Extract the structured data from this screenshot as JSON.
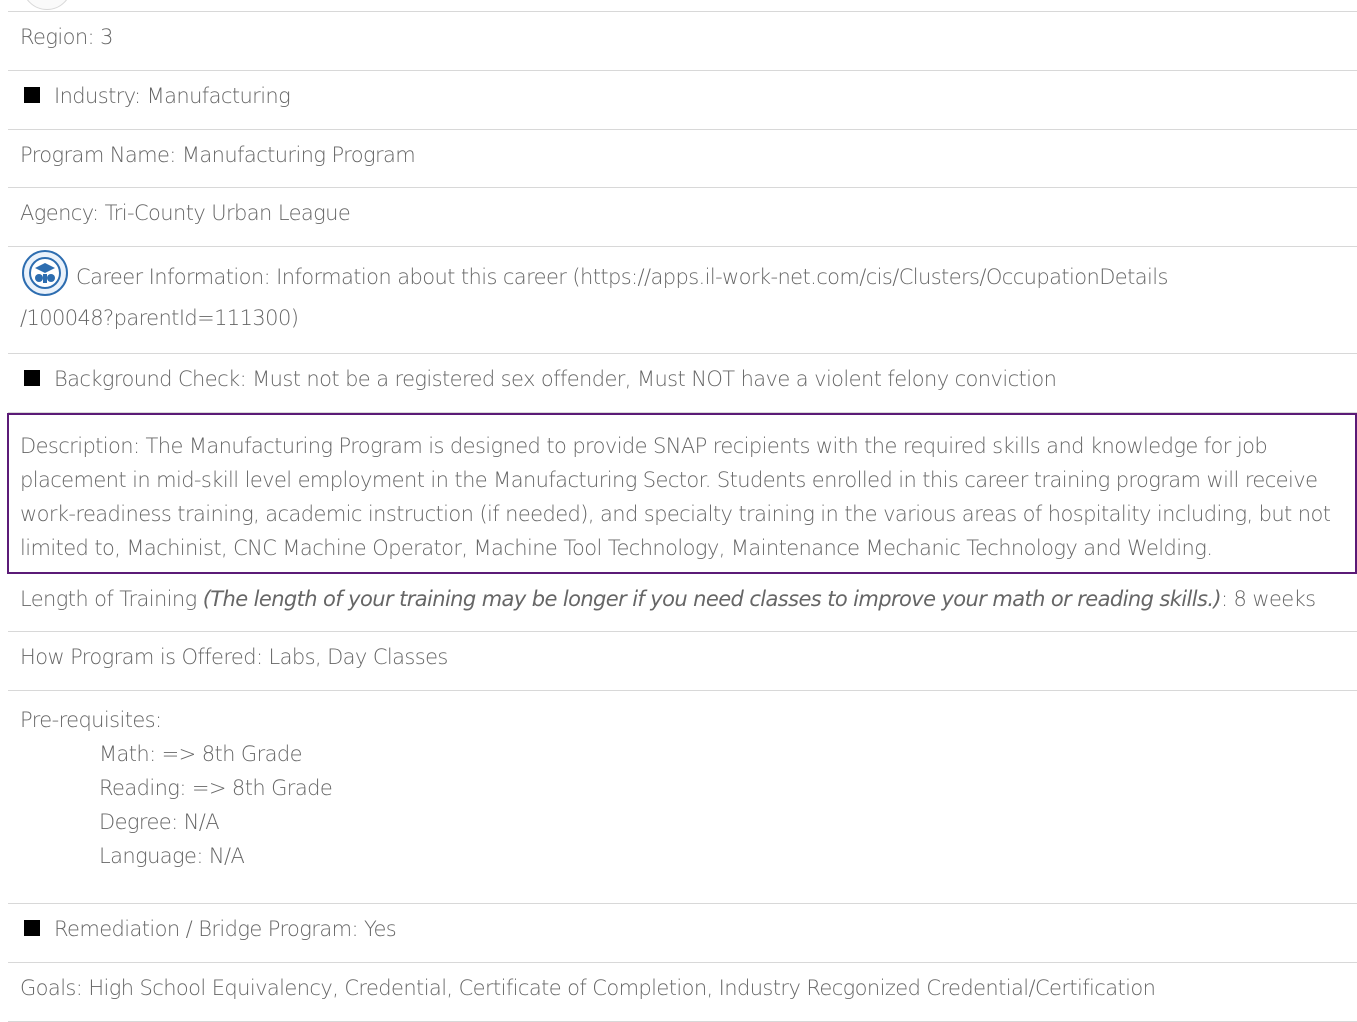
{
  "details": {
    "region": "Region: 3",
    "industry": "Industry: Manufacturing",
    "program_name": "Program Name: Manufacturing Program",
    "agency": "Agency: Tri-County Urban League",
    "career_info_line1": "Career Information: Information about this career (https://apps.il-work-net.com/cis/Clusters/OccupationDetails",
    "career_info_line2": "/100048?parentId=111300)",
    "background_check": "Background Check: Must not be a registered sex offender, Must NOT have a violent felony conviction",
    "description": "Description: The Manufacturing Program is designed to provide SNAP recipients with the required skills and knowledge for job placement in mid-skill level employment in the Manufacturing Sector. Students enrolled in this career training program will receive work-readiness training, academic instruction (if needed), and specialty training in the various areas of hospitality including, but not limited to, Machinist, CNC Machine Operator, Machine Tool Technology, Maintenance Mechanic Technology and Welding.",
    "length_label": "Length of Training ",
    "length_note": "(The length of your training may be longer if you need classes to improve your math or reading skills.)",
    "length_value": ": 8 weeks",
    "how_offered": "How Program is Offered: Labs, Day Classes",
    "prereq_label": "Pre-requisites:",
    "prereq_math": "Math: => 8th Grade",
    "prereq_reading": "Reading: => 8th Grade",
    "prereq_degree": "Degree: N/A",
    "prereq_language": "Language: N/A",
    "remediation": "Remediation / Bridge Program: Yes",
    "goals": "Goals: High School Equivalency, Credential, Certificate of Completion, Industry Recgonized Credential/Certification"
  },
  "icons": {
    "bullet": "black-square-bullet-icon",
    "career": "career-cluster-icon"
  },
  "colors": {
    "text": "#666666",
    "border": "#d8d8d8",
    "highlight_border": "#5b1b77",
    "bullet": "#000000",
    "career_icon": "#2d6db0"
  }
}
